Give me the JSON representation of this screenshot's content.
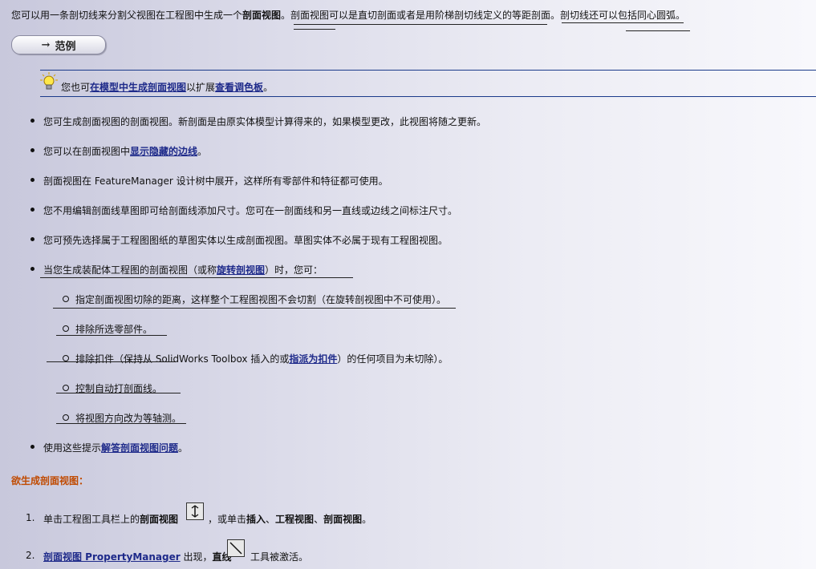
{
  "intro": {
    "text1": "您可以用一条剖切线来分割父视图在工程图中生成一个",
    "bold1": "剖面视图",
    "text2": "。剖面视图可以是直切剖面或者是用阶梯剖切线定义的等距剖面。剖切线还可以包括同心圆弧。"
  },
  "example_button": {
    "arrow": "→",
    "label": "范例"
  },
  "tip": {
    "text1": "您也可",
    "link1": "在模型中生成剖面视图",
    "text2": "以扩展",
    "link2": "查看调色板",
    "text3": "。"
  },
  "bullets": {
    "b1": "您可生成剖面视图的剖面视图。新剖面是由原实体模型计算得来的，如果模型更改，此视图将随之更新。",
    "b2_text": "您可以在剖面视图中",
    "b2_link": "显示隐藏的边线",
    "b2_end": "。",
    "b3": "剖面视图在 FeatureManager 设计树中展开，这样所有零部件和特征都可使用。",
    "b4": "您不用编辑剖面线草图即可给剖面线添加尺寸。您可在一剖面线和另一直线或边线之间标注尺寸。",
    "b5": "您可预先选择属于工程图图纸的草图实体以生成剖面视图。草图实体不必属于现有工程图视图。",
    "b6_text": "当您生成装配体工程图的剖面视图（或称",
    "b6_link": "旋转剖视图",
    "b6_end": "）时，您可：",
    "sub1": "指定剖面视图切除的距离，这样整个工程图视图不会切割（在旋转剖视图中不可使用）。",
    "sub2": "排除所选零部件。",
    "sub3_text": "排除扣件（保持从 SolidWorks Toolbox 插入的或",
    "sub3_link": "指派为扣件",
    "sub3_end": "）的任何项目为未切除）。",
    "sub4": "控制自动打剖面线。",
    "sub5": "将视图方向改为等轴测。",
    "b7_text": "使用这些提示",
    "b7_link": "解答剖面视图问题",
    "b7_end": "。"
  },
  "section_heading": "欲生成剖面视图：",
  "steps": {
    "s1_num": "1.",
    "s1_text": "单击工程图工具栏上的",
    "s1_bold": "剖面视图",
    "s1_mid": "，或单击",
    "s1_b2": "插入",
    "s1_sep1": "、",
    "s1_b3": "工程视图",
    "s1_sep2": "、",
    "s1_b4": "剖面视图",
    "s1_end": "。",
    "s2_num": "2.",
    "s2_link": "剖面视图 PropertyManager",
    "s2_text": "出现，",
    "s2_bold": "直线",
    "s2_end": "工具被激活。"
  },
  "icons": {
    "example_arrow": "arrow-right-icon",
    "tip": "lightbulb-icon",
    "section_view_tool": "section-view-tool-icon",
    "line_tool": "line-tool-icon"
  },
  "colors": {
    "link": "#1e2a8a",
    "heading": "#c04a00",
    "rule": "#1a3a8a"
  }
}
